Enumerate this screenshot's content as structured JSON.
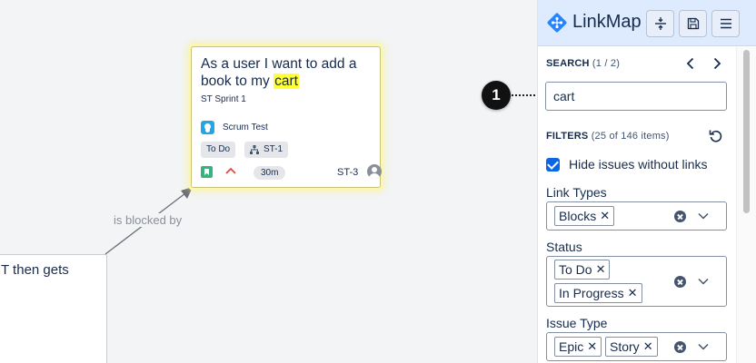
{
  "canvas": {
    "left_card_text": "T then gets",
    "edge_label": "is blocked by",
    "main_card": {
      "title_before": "As a user I want to add a book to my ",
      "title_highlight": "cart",
      "sprint": "ST Sprint 1",
      "project_name": "Scrum Test",
      "status": "To Do",
      "parent_key": "ST-1",
      "estimate": "30m",
      "issue_key": "ST-3",
      "issue_type_icon": "story-icon",
      "priority_icon": "priority-high-icon",
      "assignee_icon": "avatar-icon"
    }
  },
  "annotation": {
    "number": "1"
  },
  "panel": {
    "app_name": "LinkMap",
    "header_buttons": [
      "collapse-icon",
      "save-icon",
      "menu-icon"
    ],
    "search": {
      "label": "SEARCH",
      "count": "(1 / 2)",
      "value": "cart"
    },
    "filters": {
      "label": "FILTERS",
      "count": "(25 of 146 items)",
      "hide_without_links_label": "Hide issues without links",
      "hide_without_links_checked": true,
      "link_types": {
        "label": "Link Types",
        "values": [
          "Blocks"
        ]
      },
      "status": {
        "label": "Status",
        "values": [
          "To Do",
          "In Progress"
        ]
      },
      "issue_type": {
        "label": "Issue Type",
        "values": [
          "Epic",
          "Story"
        ]
      }
    }
  },
  "colors": {
    "highlight": "#ffff33",
    "panel_header": "#deebff",
    "checkbox": "#0c66e4",
    "marker_dot": "#f5a623",
    "story": "#36b37e"
  }
}
